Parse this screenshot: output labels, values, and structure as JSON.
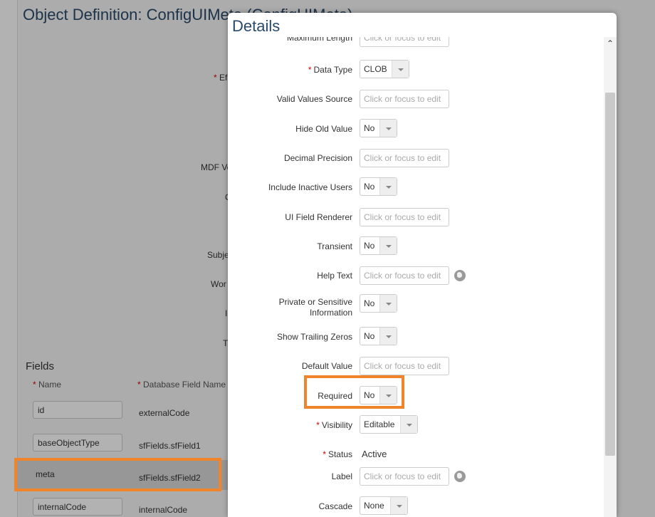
{
  "background": {
    "page_title": "Object Definition: ConfigUIMeta (ConfigUIMeta)",
    "partial_labels": [
      "Ef",
      "MDF Ve",
      "C",
      "Subje",
      "Wor",
      "I",
      "T"
    ],
    "fields": {
      "heading": "Fields",
      "col_name": "Name",
      "col_db": "Database Field Name",
      "rows": [
        {
          "name": "id",
          "db": "externalCode"
        },
        {
          "name": "baseObjectType",
          "db": "sfFields.sfField1"
        },
        {
          "name": "meta",
          "db": "sfFields.sfField2"
        },
        {
          "name": "internalCode",
          "db": "internalCode"
        }
      ]
    }
  },
  "dialog": {
    "title": "Details",
    "placeholder": "Click or focus to edit",
    "fields": {
      "maximum_length": {
        "label": "Maximum Length"
      },
      "data_type": {
        "label": "Data Type",
        "value": "CLOB"
      },
      "valid_values_source": {
        "label": "Valid Values Source"
      },
      "hide_old_value": {
        "label": "Hide Old Value",
        "value": "No"
      },
      "decimal_precision": {
        "label": "Decimal Precision"
      },
      "include_inactive_users": {
        "label": "Include Inactive Users",
        "value": "No"
      },
      "ui_field_renderer": {
        "label": "UI Field Renderer"
      },
      "transient": {
        "label": "Transient",
        "value": "No"
      },
      "help_text": {
        "label": "Help Text"
      },
      "private_sensitive": {
        "label": "Private or Sensitive Information",
        "value": "No"
      },
      "show_trailing_zeros": {
        "label": "Show Trailing Zeros",
        "value": "No"
      },
      "default_value": {
        "label": "Default Value"
      },
      "required": {
        "label": "Required",
        "value": "No"
      },
      "visibility": {
        "label": "Visibility",
        "value": "Editable"
      },
      "status": {
        "label": "Status",
        "value": "Active"
      },
      "label": {
        "label": "Label"
      },
      "cascade": {
        "label": "Cascade",
        "value": "None"
      }
    }
  },
  "icons": {
    "scroll_up": "chevron-up-icon",
    "translate": "globe-icon"
  },
  "colors": {
    "highlight": "#f0842b",
    "required_star": "#dd0000",
    "title": "#2a4a6b"
  }
}
